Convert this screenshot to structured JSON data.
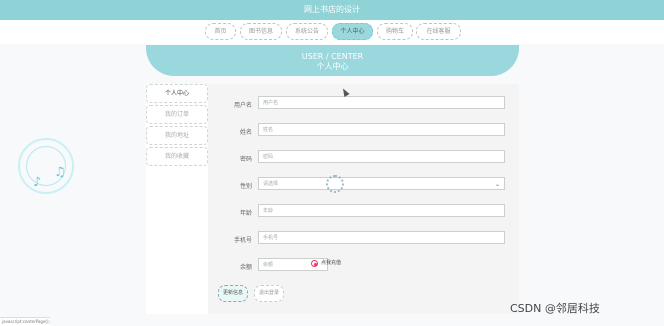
{
  "topbar": {
    "title": "网上书店的设计"
  },
  "nav": {
    "items": [
      {
        "label": "首页",
        "name": "nav-home"
      },
      {
        "label": "图书信息",
        "name": "nav-books"
      },
      {
        "label": "系统公告",
        "name": "nav-notice"
      },
      {
        "label": "个人中心",
        "name": "nav-profile"
      },
      {
        "label": "购物车",
        "name": "nav-cart"
      },
      {
        "label": "在线客服",
        "name": "nav-service"
      }
    ]
  },
  "hero": {
    "english": "USER / CENTER",
    "chinese": "个人中心"
  },
  "sidebar": {
    "items": [
      "个人中心",
      "我的订单",
      "我的地址",
      "我的收藏"
    ]
  },
  "form": {
    "username_label": "用户名",
    "username_placeholder": "用户名",
    "name_label": "姓名",
    "name_placeholder": "姓名",
    "password_label": "密码",
    "password_placeholder": "密码",
    "gender_label": "性别",
    "gender_value": "请选择",
    "age_label": "年龄",
    "age_placeholder": "年龄",
    "phone_label": "手机号",
    "phone_placeholder": "手机号",
    "balance_label": "余额",
    "balance_placeholder": "余额",
    "recharge_label": "点我充值",
    "update_button": "更新信息",
    "logout_button": "退出登录"
  },
  "status": {
    "left": "javascript:centerPage();"
  },
  "watermark": {
    "text": "CSDN @邻居科技"
  },
  "icons": {
    "music": "music-note-icon",
    "spinner": "loading-spinner-icon",
    "arrow": "chevron-down-icon",
    "radio": "radio-selected-icon"
  }
}
